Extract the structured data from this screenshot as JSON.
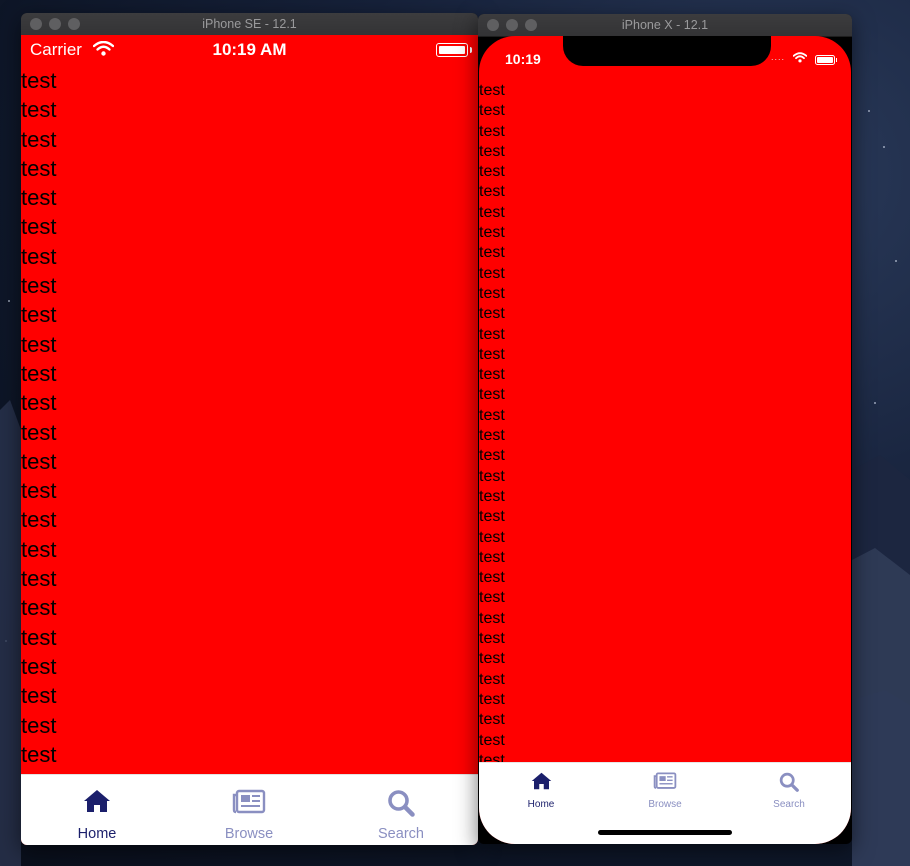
{
  "se": {
    "window_title": "iPhone SE - 12.1",
    "status": {
      "carrier": "Carrier",
      "time": "10:19 AM"
    },
    "rows": [
      "test",
      "test",
      "test",
      "test",
      "test",
      "test",
      "test",
      "test",
      "test",
      "test",
      "test",
      "test",
      "test",
      "test",
      "test",
      "test",
      "test",
      "test",
      "test",
      "test",
      "test",
      "test",
      "test",
      "test",
      "test"
    ],
    "tabs": [
      {
        "label": "Home",
        "icon": "home-icon"
      },
      {
        "label": "Browse",
        "icon": "newspaper-icon"
      },
      {
        "label": "Search",
        "icon": "search-icon"
      }
    ]
  },
  "x": {
    "window_title": "iPhone X - 12.1",
    "status": {
      "time": "10:19"
    },
    "rows": [
      "test",
      "test",
      "test",
      "test",
      "test",
      "test",
      "test",
      "test",
      "test",
      "test",
      "test",
      "test",
      "test",
      "test",
      "test",
      "test",
      "test",
      "test",
      "test",
      "test",
      "test",
      "test",
      "test",
      "test",
      "test",
      "test",
      "test",
      "test",
      "test",
      "test",
      "test",
      "test",
      "test",
      "test",
      "test"
    ],
    "tabs": [
      {
        "label": "Home",
        "icon": "home-icon"
      },
      {
        "label": "Browse",
        "icon": "newspaper-icon"
      },
      {
        "label": "Search",
        "icon": "search-icon"
      }
    ]
  },
  "colors": {
    "background": "#ff0000",
    "tab_active": "#1b1f6b",
    "tab_inactive": "#8a8fc1"
  }
}
